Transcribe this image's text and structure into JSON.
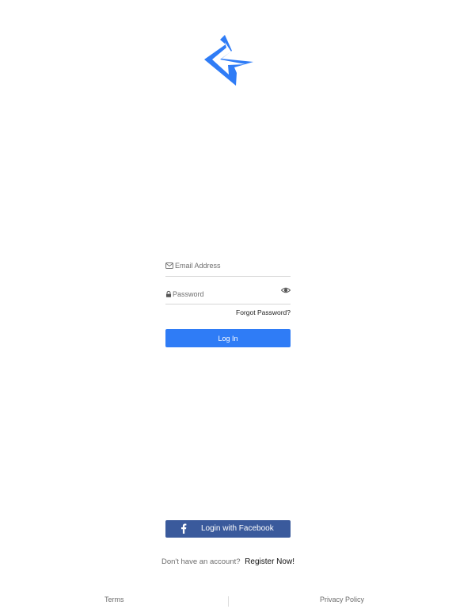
{
  "brand": {
    "accent_color": "#2f7cf6",
    "logo_icon": "lightning-arrow-logo"
  },
  "login_form": {
    "email": {
      "icon": "envelope-icon",
      "placeholder": "Email Address",
      "value": ""
    },
    "password": {
      "icon": "lock-icon",
      "placeholder": "Password",
      "value": "",
      "toggle_icon": "eye-icon"
    },
    "forgot_password_label": "Forgot Password?",
    "login_button_label": "Log In",
    "login_button_color": "#2f7cf6"
  },
  "social": {
    "facebook_label": "Login with Facebook",
    "facebook_icon": "facebook-icon",
    "facebook_color": "#3a5a9c"
  },
  "register": {
    "prompt": "Don't have an account?",
    "link_label": "Register Now!"
  },
  "footer": {
    "terms_label": "Terms",
    "privacy_label": "Privacy Policy"
  }
}
